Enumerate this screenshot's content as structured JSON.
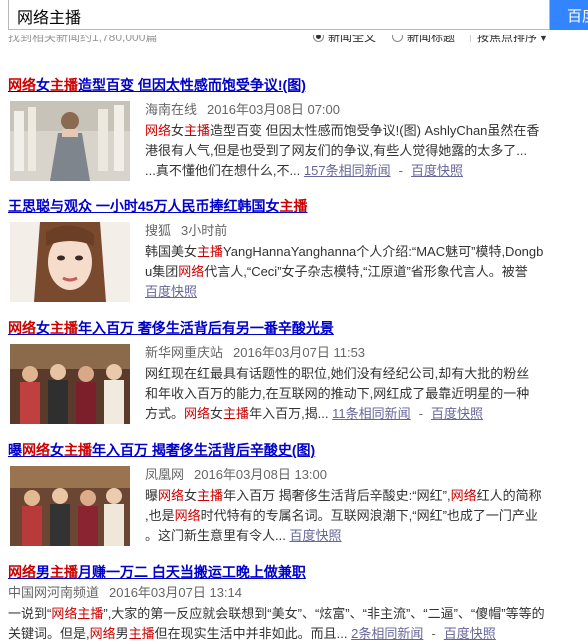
{
  "search": {
    "query": "网络主播",
    "button_label": "百度"
  },
  "status": {
    "count_text": "找到相关新闻约1,780,000篇",
    "option_fulltext": "新闻全文",
    "option_title": "新闻标题",
    "sort_label": "按焦点排序"
  },
  "results": [
    {
      "title_parts": [
        "网络",
        "女",
        "主播",
        "造型百变 但因太性感而饱受争议!(图)"
      ],
      "source": "海南在线",
      "time": "2016年03月08日 07:00",
      "summary_l1_parts": [
        "网络",
        "女",
        "主播",
        "造型百变 但因太性感而饱受争议!(图) AshlyChan虽然在香"
      ],
      "summary_l2": "港很有人气,但是也受到了网友们的争议,有些人觉得她露的太多了...",
      "summary_l3": "...真不懂他们在想什么,不...",
      "related": "157条相同新闻",
      "snapshot": "百度快照"
    },
    {
      "title_parts": [
        "王思聪与观众 一小时45万人民币捧红韩国女",
        "主播"
      ],
      "source": "搜狐",
      "time": "3小时前",
      "summary_l1_parts": [
        "韩国美女",
        "主播",
        "YangHannaYanghanna个人介绍:“MAC魅可”模特,Dongb"
      ],
      "summary_l2_parts": [
        "u集团",
        "网络",
        "代言人,“Ceci”女子杂志模特,“江原道”省形象代言人。被誉"
      ],
      "snapshot": "百度快照"
    },
    {
      "title_parts": [
        "网络",
        "女",
        "主播",
        "年入百万 奢侈生活背后有另一番辛酸光景"
      ],
      "source": "新华网重庆站",
      "time": "2016年03月07日 11:53",
      "summary_l1": "网红现在红最具有话题性的职位,她们没有经纪公司,却有大批的粉丝",
      "summary_l2": "和年收入百万的能力,在互联网的推动下,网红成了最靠近明星的一种",
      "summary_l3_parts": [
        "方式。",
        "网络",
        "女",
        "主播",
        "年入百万,揭..."
      ],
      "related": "11条相同新闻",
      "snapshot": "百度快照"
    },
    {
      "title_parts": [
        "曝",
        "网络",
        "女",
        "主播",
        "年入百万 揭奢侈生活背后辛酸史(图)"
      ],
      "source": "凤凰网",
      "time": "2016年03月08日 13:00",
      "summary_l1_parts": [
        "曝",
        "网络",
        "女",
        "主播",
        "年入百万 揭奢侈生活背后辛酸史:“网红”,",
        "网络",
        "红人的简称"
      ],
      "summary_l2_parts": [
        ",也是",
        "网络",
        "时代特有的专属名词。互联网浪潮下,“网红”也成了一门产业"
      ],
      "summary_l3": "。这门新生意里有令人...",
      "snapshot": "百度快照"
    },
    {
      "title_parts": [
        "网络",
        "男",
        "主播",
        "月赚一万二 白天当搬运工晚上做兼职"
      ],
      "source": "中国网河南频道",
      "time": "2016年03月07日 13:14",
      "summary_l1_parts": [
        "一说到“",
        "网络主播",
        "”,大家的第一反应就会联想到“美女”、“炫富”、“非主流”、“二逼”、“傻帽”等等的"
      ],
      "summary_l2_parts": [
        "关键词。但是,",
        "网络",
        "男",
        "主播",
        "但在现实生活中并非如此。而且...",
        "2条相同新闻",
        "百度快照"
      ]
    }
  ]
}
